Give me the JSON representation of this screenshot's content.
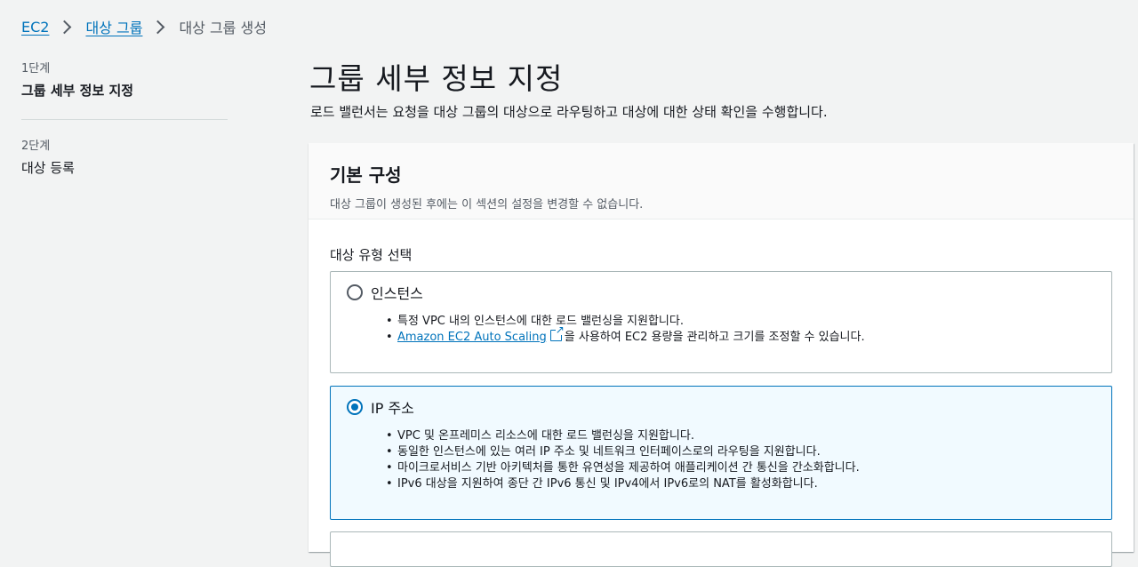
{
  "breadcrumb": {
    "items": [
      {
        "label": "EC2"
      },
      {
        "label": "대상 그룹"
      }
    ],
    "current": "대상 그룹 생성"
  },
  "steps": [
    {
      "number": "1단계",
      "title": "그룹 세부 정보 지정"
    },
    {
      "number": "2단계",
      "title": "대상 등록"
    }
  ],
  "page": {
    "title": "그룹 세부 정보 지정",
    "description": "로드 밸런서는 요청을 대상 그룹의 대상으로 라우팅하고 대상에 대한 상태 확인을 수행합니다."
  },
  "panel": {
    "title": "기본 구성",
    "description": "대상 그룹이 생성된 후에는 이 섹션의 설정을 변경할 수 없습니다.",
    "field_label": "대상 유형 선택",
    "options": [
      {
        "label": "인스턴스",
        "selected": false,
        "bullets": [
          "특정 VPC 내의 인스턴스에 대한 로드 밸런싱을 지원합니다.",
          "을 사용하여 EC2 용량을 관리하고 크기를 조정할 수 있습니다."
        ],
        "link_text": "Amazon EC2 Auto Scaling"
      },
      {
        "label": "IP 주소",
        "selected": true,
        "bullets": [
          "VPC 및 온프레미스 리소스에 대한 로드 밸런싱을 지원합니다.",
          "동일한 인스턴스에 있는 여러 IP 주소 및 네트워크 인터페이스로의 라우팅을 지원합니다.",
          "마이크로서비스 기반 아키텍처를 통한 유연성을 제공하여 애플리케이션 간 통신을 간소화합니다.",
          "IPv6 대상을 지원하여 종단 간 IPv6 통신 및 IPv4에서 IPv6로의 NAT를 활성화합니다."
        ]
      }
    ]
  },
  "colors": {
    "link": "#0073bb",
    "selected_bg": "#f1faff",
    "page_bg": "#f2f3f3"
  }
}
